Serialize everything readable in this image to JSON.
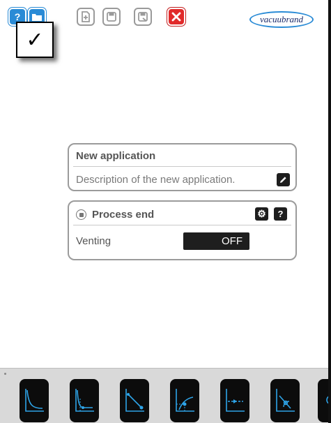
{
  "toolbar": {
    "buttons": [
      {
        "icon": "question-icon"
      },
      {
        "icon": "open-folder-icon"
      },
      {
        "icon": "new-document-icon"
      },
      {
        "icon": "save-icon"
      },
      {
        "icon": "save-as-icon"
      },
      {
        "icon": "close-icon"
      }
    ],
    "logo_text": "vacuubrand"
  },
  "overlay": {
    "check_glyph": "✓"
  },
  "application": {
    "title": "New application",
    "description": "Description of the new application."
  },
  "process_end": {
    "title": "Process end",
    "venting_label": "Venting",
    "venting_value": "OFF"
  },
  "dock": {
    "modes": [
      {
        "icon": "pump-down-icon"
      },
      {
        "icon": "pressure-control-icon"
      },
      {
        "icon": "gradient-icon"
      },
      {
        "icon": "auto-mode-icon"
      },
      {
        "icon": "program-icon"
      },
      {
        "icon": "vacuum-gauge-icon"
      },
      {
        "icon": "more-modes-icon"
      }
    ]
  },
  "colors": {
    "accent": "#2a8bd6",
    "close": "#e12a2a",
    "dock_icon": "#2ea4e8"
  }
}
